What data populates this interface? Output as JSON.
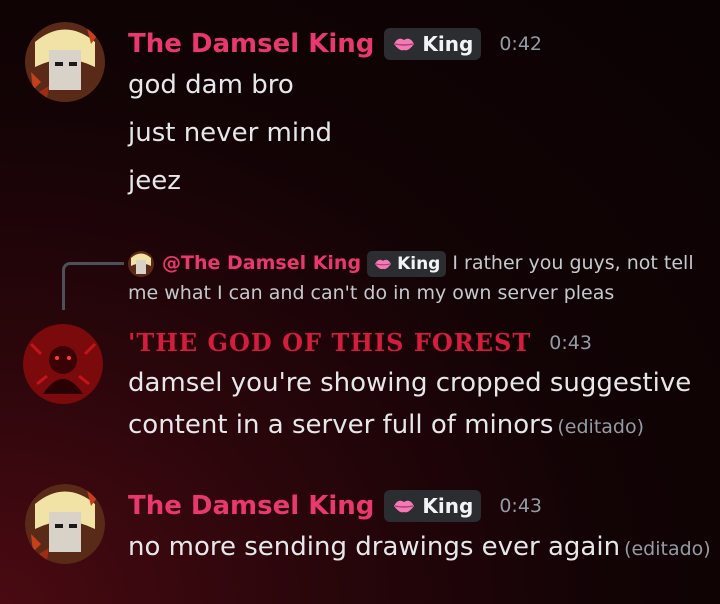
{
  "messages": [
    {
      "username": "The Damsel King",
      "role_tag": "King",
      "time": "0:42",
      "lines": [
        "god dam bro",
        "just never mind",
        "jeez"
      ]
    },
    {
      "reply": {
        "mention": "@The Damsel King",
        "role_tag": "King",
        "text": "I rather you guys, not tell me what I can and can't do in my own server pleas"
      },
      "username": "'THE GOD OF THIS FOREST",
      "time": "0:43",
      "lines": [
        "damsel you're showing cropped suggestive",
        "content in a server full of minors"
      ],
      "edited": "(editado)"
    },
    {
      "username": "The Damsel King",
      "role_tag": "King",
      "time": "0:43",
      "lines": [
        "no more sending drawings ever again"
      ],
      "edited": "(editado)"
    }
  ],
  "colors": {
    "username_pink": "#e8386d",
    "username_red": "#d41c3c",
    "timestamp": "#949ba4",
    "tag_bg": "#2b2d31"
  },
  "icons": {
    "role_icon": "lips-icon"
  }
}
